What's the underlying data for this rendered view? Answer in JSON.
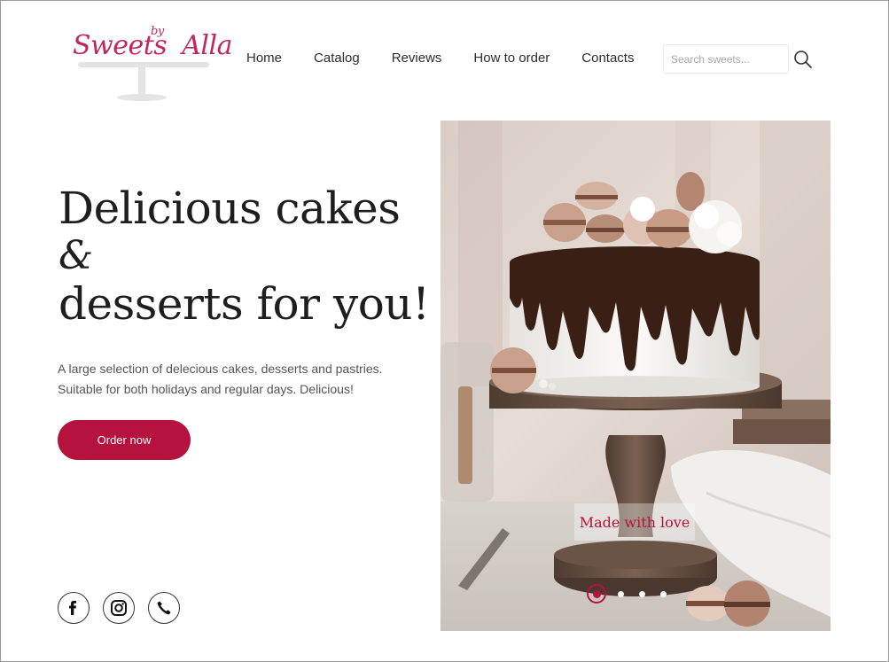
{
  "logo": {
    "main": "Sweets",
    "by": "by",
    "name": "Alla"
  },
  "nav": {
    "items": [
      {
        "label": "Home"
      },
      {
        "label": "Catalog"
      },
      {
        "label": "Reviews"
      },
      {
        "label": "How to order"
      },
      {
        "label": "Contacts"
      }
    ]
  },
  "search": {
    "placeholder": "Search sweets...",
    "value": "",
    "icon": "search-icon"
  },
  "hero": {
    "title_line1": "Delicious cakes",
    "title_amp": "&",
    "title_line2": "desserts for you!",
    "description_line1": "A large selection of delecious cakes, desserts and pastries.",
    "description_line2": "Suitable for both holidays and regular days. Delicious!",
    "cta_label": "Order now"
  },
  "slider": {
    "caption": "Made with love",
    "slides": 4,
    "active_slide": 1
  },
  "social": [
    {
      "icon": "facebook-icon"
    },
    {
      "icon": "instagram-icon"
    },
    {
      "icon": "phone-icon"
    }
  ],
  "colors": {
    "accent": "#b5123e",
    "logo": "#c0285a",
    "text": "#1e1e1e",
    "muted": "#555555"
  }
}
